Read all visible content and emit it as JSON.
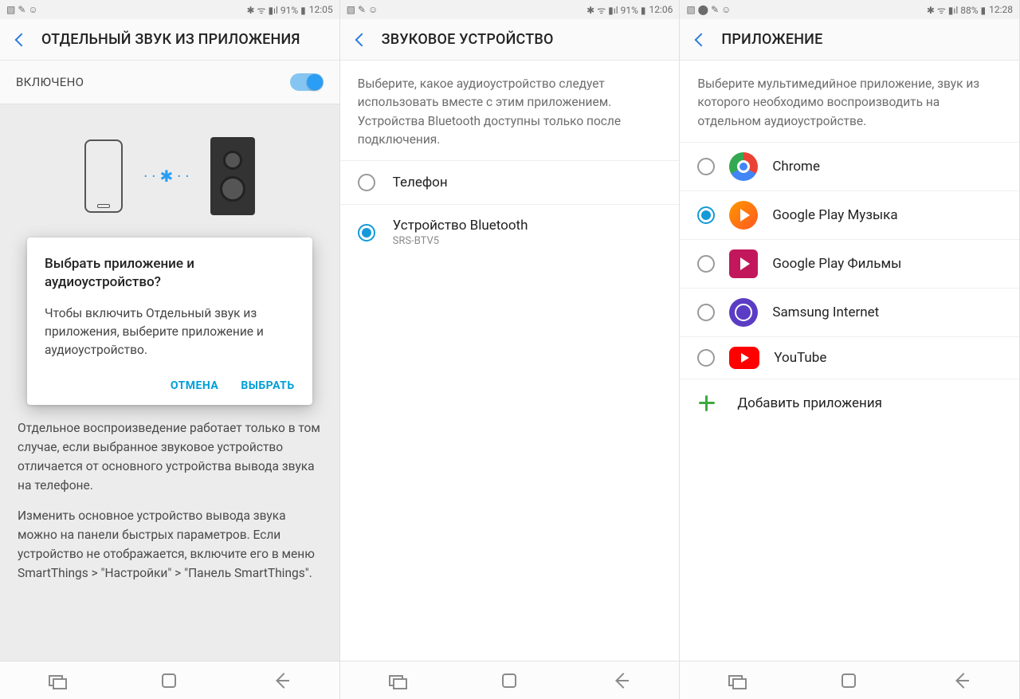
{
  "screen1": {
    "status": {
      "left_icons": "▧ ✎ ☺",
      "right_icons": "✱ ᯤ ▮ıl 91% ▮",
      "time": "12:05"
    },
    "title": "ОТДЕЛЬНЫЙ ЗВУК ИЗ ПРИЛОЖЕНИЯ",
    "toggle_label": "ВКЛЮЧЕНО",
    "dialog": {
      "title": "Выбрать приложение и аудиоустройство?",
      "body": "Чтобы включить Отдельный звук из приложения, выберите приложение и аудиоустройство.",
      "cancel": "ОТМЕНА",
      "select": "ВЫБРАТЬ"
    },
    "para1": "Отдельное воспроизведение работает только в том случае, если выбранное звуковое устройство отличается от основного устройства вывода звука на телефоне.",
    "para2": "Изменить основное устройство вывода звука можно на панели быстрых параметров. Если устройство не отображается, включите его в меню SmartThings > \"Настройки\" > \"Панель SmartThings\"."
  },
  "screen2": {
    "status": {
      "left_icons": "▧ ✎ ☺",
      "right_icons": "✱ ᯤ ▮ıl 91% ▮",
      "time": "12:06"
    },
    "title": "ЗВУКОВОЕ УСТРОЙСТВО",
    "desc": "Выберите, какое аудиоустройство следует использовать вместе с этим приложением. Устройства Bluetooth доступны только после подключения.",
    "options": [
      {
        "label": "Телефон",
        "sub": "",
        "checked": false
      },
      {
        "label": "Устройство Bluetooth",
        "sub": "SRS-BTV5",
        "checked": true
      }
    ]
  },
  "screen3": {
    "status": {
      "left_icons": "▧ ⬤ ✎ ☺",
      "right_icons": "✱ ᯤ ▮ıl 88% ▮",
      "time": "12:28"
    },
    "title": "ПРИЛОЖЕНИЕ",
    "desc": "Выберите мультимедийное приложение, звук из которого необходимо воспроизводить на отдельном аудиоустройстве.",
    "apps": [
      {
        "label": "Chrome",
        "icon": "ic-chrome",
        "checked": false
      },
      {
        "label": "Google Play Музыка",
        "icon": "ic-playmusic",
        "checked": true
      },
      {
        "label": "Google Play Фильмы",
        "icon": "ic-playmovies",
        "checked": false
      },
      {
        "label": "Samsung Internet",
        "icon": "ic-samsung",
        "checked": false
      },
      {
        "label": "YouTube",
        "icon": "ic-youtube",
        "checked": false
      }
    ],
    "add_label": "Добавить приложения"
  }
}
